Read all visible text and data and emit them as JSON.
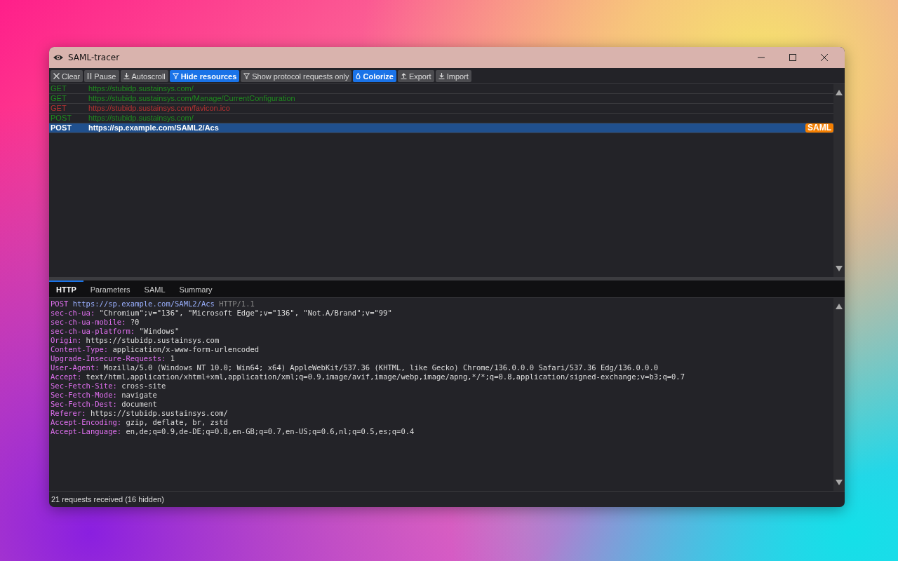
{
  "window": {
    "title": "SAML-tracer"
  },
  "toolbar": [
    {
      "label": "Clear",
      "kind": "close",
      "on": false
    },
    {
      "label": "Pause",
      "kind": "pause",
      "on": false
    },
    {
      "label": "Autoscroll",
      "kind": "download",
      "on": false
    },
    {
      "label": "Hide resources",
      "kind": "filter",
      "on": true
    },
    {
      "label": "Show protocol requests only",
      "kind": "filter",
      "on": false
    },
    {
      "label": "Colorize",
      "kind": "drop",
      "on": true
    },
    {
      "label": "Export",
      "kind": "upload",
      "on": false
    },
    {
      "label": "Import",
      "kind": "download",
      "on": false
    }
  ],
  "requests": [
    {
      "method": "GET",
      "url": "https://stubidp.sustainsys.com/",
      "color": "#1e8c1e",
      "selected": false
    },
    {
      "method": "GET",
      "url": "https://stubidp.sustainsys.com/Manage/CurrentConfiguration",
      "color": "#1e8c1e",
      "selected": false
    },
    {
      "method": "GET",
      "url": "https://stubidp.sustainsys.com/favicon.ico",
      "color": "#b83232",
      "selected": false
    },
    {
      "method": "POST",
      "url": "https://stubidp.sustainsys.com/",
      "color": "#1e8c1e",
      "selected": false
    },
    {
      "method": "POST",
      "url": "https://sp.example.com/SAML2/Acs",
      "selected": true,
      "badge": "SAML"
    }
  ],
  "tabs": [
    {
      "label": "HTTP",
      "selected": true
    },
    {
      "label": "Parameters",
      "selected": false
    },
    {
      "label": "SAML",
      "selected": false
    },
    {
      "label": "Summary",
      "selected": false
    }
  ],
  "request_line": {
    "method": "POST",
    "url": "https://sp.example.com/SAML2/Acs",
    "version": "HTTP/1.1"
  },
  "headers": [
    {
      "name": "sec-ch-ua:",
      "value": "\"Chromium\";v=\"136\", \"Microsoft Edge\";v=\"136\", \"Not.A/Brand\";v=\"99\""
    },
    {
      "name": "sec-ch-ua-mobile:",
      "value": "?0"
    },
    {
      "name": "sec-ch-ua-platform:",
      "value": "\"Windows\""
    },
    {
      "name": "Origin:",
      "value": "https://stubidp.sustainsys.com"
    },
    {
      "name": "Content-Type:",
      "value": "application/x-www-form-urlencoded"
    },
    {
      "name": "Upgrade-Insecure-Requests:",
      "value": "1"
    },
    {
      "name": "User-Agent:",
      "value": "Mozilla/5.0 (Windows NT 10.0; Win64; x64) AppleWebKit/537.36 (KHTML, like Gecko) Chrome/136.0.0.0 Safari/537.36 Edg/136.0.0.0"
    },
    {
      "name": "Accept:",
      "value": "text/html,application/xhtml+xml,application/xml;q=0.9,image/avif,image/webp,image/apng,*/*;q=0.8,application/signed-exchange;v=b3;q=0.7"
    },
    {
      "name": "Sec-Fetch-Site:",
      "value": "cross-site"
    },
    {
      "name": "Sec-Fetch-Mode:",
      "value": "navigate"
    },
    {
      "name": "Sec-Fetch-Dest:",
      "value": "document"
    },
    {
      "name": "Referer:",
      "value": "https://stubidp.sustainsys.com/"
    },
    {
      "name": "Accept-Encoding:",
      "value": "gzip, deflate, br, zstd"
    },
    {
      "name": "Accept-Language:",
      "value": "en,de;q=0.9,de-DE;q=0.8,en-GB;q=0.7,en-US;q=0.6,nl;q=0.5,es;q=0.4"
    }
  ],
  "status_bar": "21 requests received (16 hidden)"
}
